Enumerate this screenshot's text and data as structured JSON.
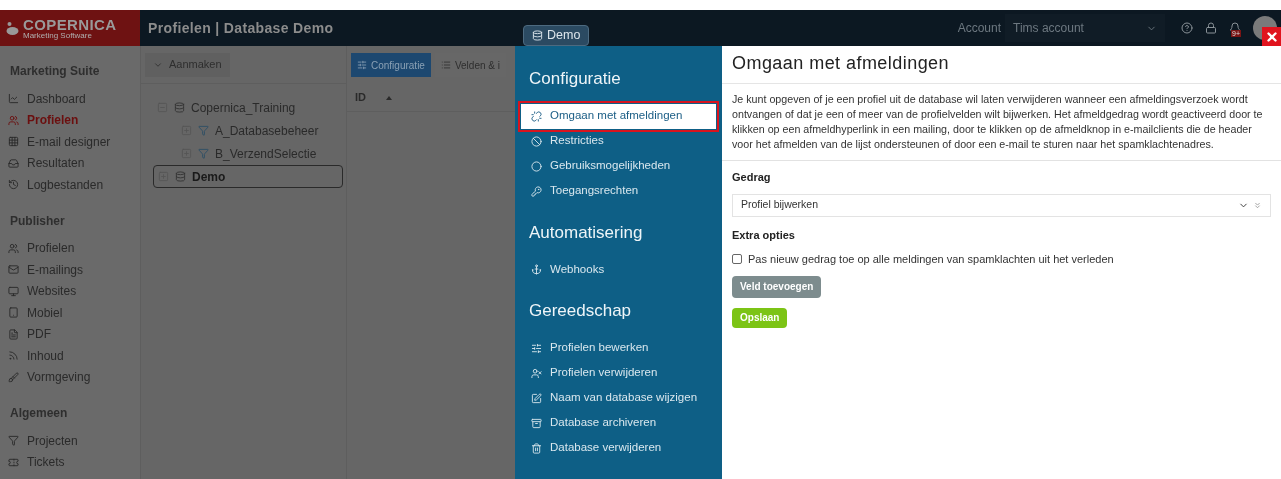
{
  "header": {
    "logo": {
      "name": "COPERNICA",
      "tagline": "Marketing Software"
    },
    "title": "Profielen | Database Demo",
    "database_button": "Demo",
    "account_label": "Account",
    "account_select": "Tims account",
    "notification_badge": "9+"
  },
  "sidebar": {
    "sections": [
      {
        "title": "Marketing Suite",
        "items": [
          {
            "label": "Dashboard",
            "selected": false
          },
          {
            "label": "Profielen",
            "selected": true
          },
          {
            "label": "E-mail designer",
            "selected": false
          },
          {
            "label": "Resultaten",
            "selected": false
          },
          {
            "label": "Logbestanden",
            "selected": false
          }
        ]
      },
      {
        "title": "Publisher",
        "items": [
          {
            "label": "Profielen",
            "selected": false
          },
          {
            "label": "E-mailings",
            "selected": false
          },
          {
            "label": "Websites",
            "selected": false
          },
          {
            "label": "Mobiel",
            "selected": false
          },
          {
            "label": "PDF",
            "selected": false
          },
          {
            "label": "Inhoud",
            "selected": false
          },
          {
            "label": "Vormgeving",
            "selected": false
          }
        ]
      },
      {
        "title": "Algemeen",
        "items": [
          {
            "label": "Projecten",
            "selected": false
          },
          {
            "label": "Tickets",
            "selected": false
          }
        ]
      }
    ]
  },
  "tree": {
    "create_button": "Aanmaken",
    "nodes": [
      {
        "label": "Copernica_Training",
        "kind": "database",
        "expanded": true,
        "selected": false,
        "children": [
          {
            "label": "A_Databasebeheer",
            "kind": "selection",
            "expanded": false,
            "selected": false
          },
          {
            "label": "B_VerzendSelectie",
            "kind": "selection",
            "expanded": false,
            "selected": false
          }
        ]
      },
      {
        "label": "Demo",
        "kind": "database",
        "expanded": false,
        "selected": true
      }
    ]
  },
  "table": {
    "tabs": [
      {
        "label": "Configuratie",
        "selected": true
      },
      {
        "label": "Velden & i",
        "selected": false
      }
    ],
    "columns": [
      "ID"
    ]
  },
  "config_menu": {
    "sections": [
      {
        "title": "Configuratie",
        "items": [
          {
            "label": "Omgaan met afmeldingen",
            "selected": true
          },
          {
            "label": "Restricties",
            "selected": false
          },
          {
            "label": "Gebruiksmogelijkheden",
            "selected": false
          },
          {
            "label": "Toegangsrechten",
            "selected": false
          }
        ]
      },
      {
        "title": "Automatisering",
        "items": [
          {
            "label": "Webhooks",
            "selected": false
          }
        ]
      },
      {
        "title": "Gereedschap",
        "items": [
          {
            "label": "Profielen bewerken",
            "selected": false
          },
          {
            "label": "Profielen verwijderen",
            "selected": false
          },
          {
            "label": "Naam van database wijzigen",
            "selected": false
          },
          {
            "label": "Database archiveren",
            "selected": false
          },
          {
            "label": "Database verwijderen",
            "selected": false
          }
        ]
      }
    ]
  },
  "content": {
    "title": "Omgaan met afmeldingen",
    "description": "Je kunt opgeven of je een profiel uit de database wil laten verwijderen wanneer een afmeldingsverzoek wordt ontvangen of dat je een of meer van de profielvelden wilt bijwerken. Het afmeldgedrag wordt geactiveerd door te klikken op een afmeldhyperlink in een mailing, door te klikken op de afmeldknop in e-mailclients die de header voor het afmelden van de lijst ondersteunen of door een e-mail te sturen naar het spamklachtenadres.",
    "behavior_label": "Gedrag",
    "behavior_value": "Profiel bijwerken",
    "extra_label": "Extra opties",
    "extra_checkbox": {
      "label": "Pas nieuw gedrag toe op alle meldingen van spamklachten uit het verleden",
      "checked": false
    },
    "add_field_button": "Veld toevoegen",
    "save_button": "Opslaan"
  }
}
